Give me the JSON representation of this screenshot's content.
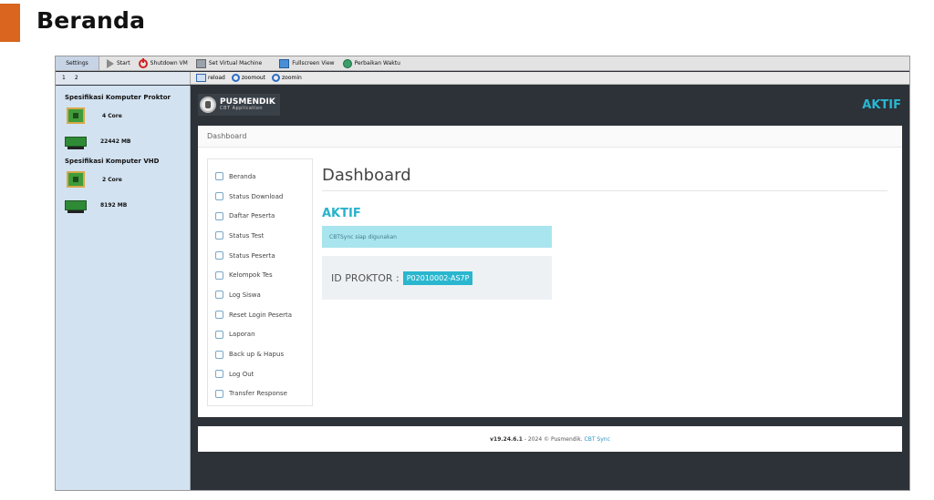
{
  "slide": {
    "title": "Beranda"
  },
  "toolbar": {
    "settings": "Settings",
    "start": "Start",
    "shutdown": "Shutdown VM",
    "set_vm": "Set Virtual Machine",
    "fullscreen": "Fullscreen View",
    "fix_time": "Perbaikan Waktu"
  },
  "tabs": [
    "1",
    "2"
  ],
  "zoombar": {
    "reload": "reload",
    "zoomout": "zoomout",
    "zoomin": "zoomin"
  },
  "specs": {
    "proktor_title": "Spesifikasi Komputer Proktor",
    "proktor_cpu": "4 Core",
    "proktor_ram": "22442 MB",
    "vhd_title": "Spesifikasi Komputer VHD",
    "vhd_cpu": "2 Core",
    "vhd_ram": "8192 MB"
  },
  "app": {
    "logo_main": "PUSMENDIK",
    "logo_sub": "CBT Application",
    "status_top": "AKTIF",
    "breadcrumb": "Dashboard",
    "menu": [
      "Beranda",
      "Status Download",
      "Daftar Peserta",
      "Status Test",
      "Status Peserta",
      "Kelompok Tes",
      "Log Siswa",
      "Reset Login Peserta",
      "Laporan",
      "Back up & Hapus",
      "Log Out",
      "Transfer Response"
    ],
    "content_title": "Dashboard",
    "status": "AKTIF",
    "alert": "CBTSync siap digunakan",
    "id_label": "ID PROKTOR :",
    "id_value": "P02010002-AS7P"
  },
  "footer": {
    "version": "v19.24.6.1",
    "text": " - 2024 © Pusmendik. ",
    "link": "CBT Sync"
  }
}
